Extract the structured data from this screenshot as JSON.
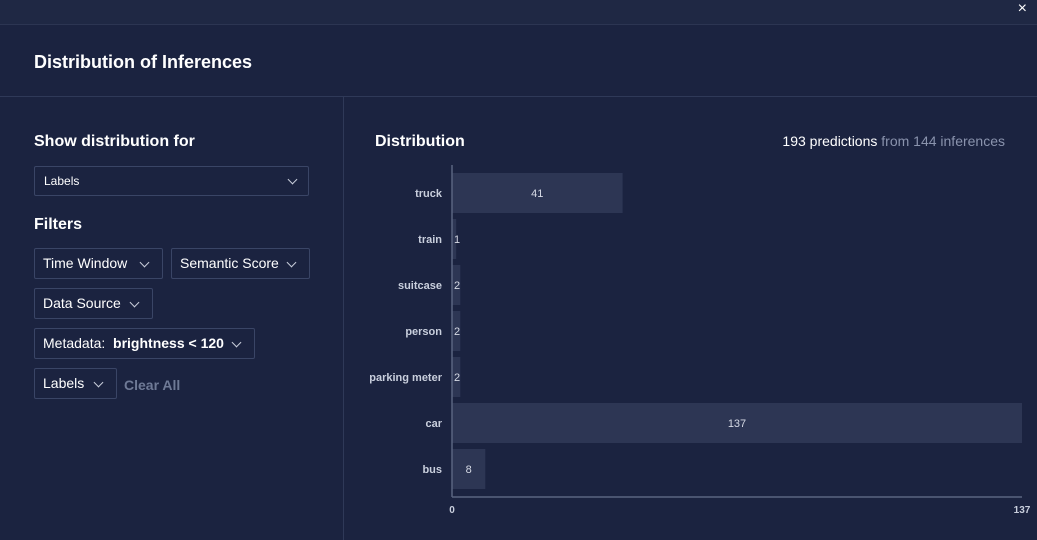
{
  "modal": {
    "title": "Distribution of Inferences",
    "close_icon": "×"
  },
  "left": {
    "show_distribution_for_title": "Show distribution for",
    "distribution_select_value": "Labels",
    "filters_title": "Filters",
    "filters": {
      "time_window": "Time Window",
      "semantic_score": "Semantic Score",
      "data_source": "Data Source",
      "metadata_prefix": "Metadata:",
      "metadata_value": "brightness < 120",
      "labels": "Labels"
    },
    "clear_all": "Clear All"
  },
  "right": {
    "title": "Distribution",
    "summary_strong": "193 predictions",
    "summary_muted": "from 144 inferences"
  },
  "colors": {
    "background": "#1b2340",
    "bar": "#2d3654",
    "axis": "#5a6480",
    "muted_text": "#8a93ad"
  },
  "chart_data": {
    "type": "bar",
    "orientation": "horizontal",
    "categories": [
      "truck",
      "train",
      "suitcase",
      "person",
      "parking meter",
      "car",
      "bus"
    ],
    "values": [
      41,
      1,
      2,
      2,
      2,
      137,
      8
    ],
    "xlim": [
      0,
      137
    ],
    "x_tick_labels": [
      "0",
      "137"
    ],
    "data_labels": [
      "41",
      "1",
      "2",
      "2",
      "2",
      "137",
      "8"
    ]
  }
}
